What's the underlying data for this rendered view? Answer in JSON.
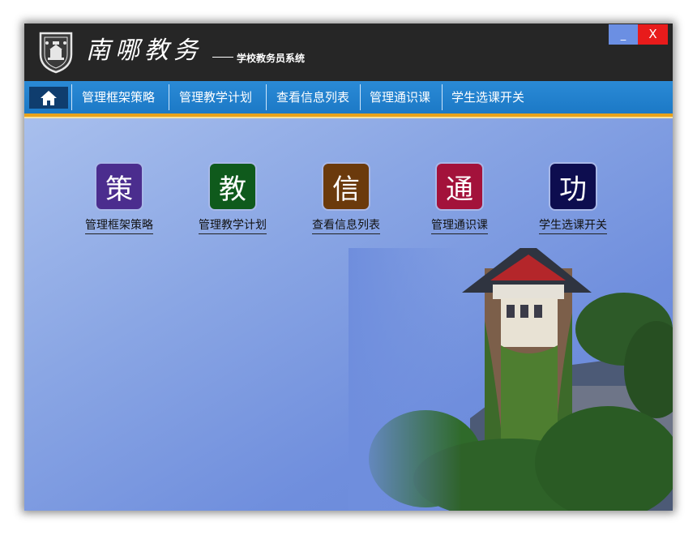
{
  "header": {
    "app_name": "南哪教务",
    "subtitle": "学校教务员系统"
  },
  "window_controls": {
    "minimize": "_",
    "close": "X"
  },
  "nav": {
    "items": [
      {
        "label": "管理框架策略"
      },
      {
        "label": "管理教学计划"
      },
      {
        "label": "查看信息列表"
      },
      {
        "label": "管理通识课"
      },
      {
        "label": "学生选课开关"
      }
    ]
  },
  "tiles": [
    {
      "glyph": "策",
      "label": "管理框架策略",
      "color": "#4b2d8e"
    },
    {
      "glyph": "教",
      "label": "管理教学计划",
      "color": "#0f5a1c"
    },
    {
      "glyph": "信",
      "label": "查看信息列表",
      "color": "#6b3a0c"
    },
    {
      "glyph": "通",
      "label": "管理通识课",
      "color": "#a3123b"
    },
    {
      "glyph": "功",
      "label": "学生选课开关",
      "color": "#0d0d4f"
    }
  ],
  "icons": {
    "home": "home-icon",
    "logo": "university-emblem-icon"
  }
}
